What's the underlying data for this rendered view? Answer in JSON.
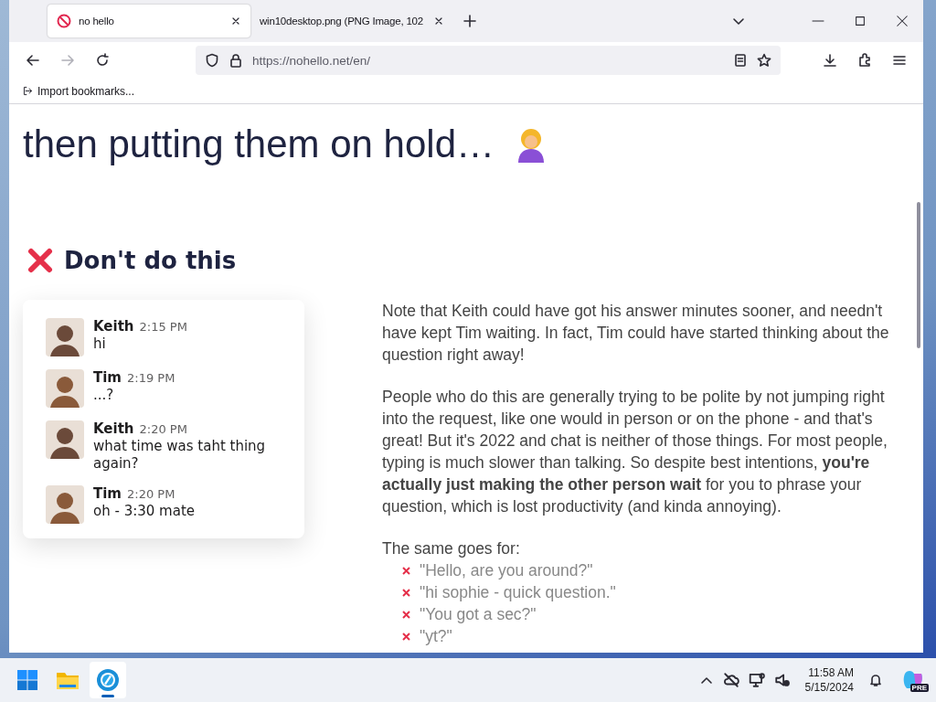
{
  "browser": {
    "tabs": [
      {
        "title": "no hello",
        "selected": true
      },
      {
        "title": "win10desktop.png (PNG Image, 102",
        "selected": false
      }
    ],
    "url": "https://nohello.net/en/",
    "bookmarks": [
      "Import bookmarks..."
    ]
  },
  "page": {
    "heading": "then putting them on hold…",
    "section_title": "Don't do this",
    "chat": [
      {
        "author": "Keith",
        "time": "2:15 PM",
        "text": "hi",
        "color": "#6b4a3a"
      },
      {
        "author": "Tim",
        "time": "2:19 PM",
        "text": "...?",
        "color": "#8a5a3a"
      },
      {
        "author": "Keith",
        "time": "2:20 PM",
        "text": "what time was taht thing again?",
        "color": "#6b4a3a"
      },
      {
        "author": "Tim",
        "time": "2:20 PM",
        "text": "oh - 3:30 mate",
        "color": "#8a5a3a"
      }
    ],
    "paragraphs": [
      "Note that Keith could have got his answer minutes sooner, and needn't have kept Tim waiting. In fact, Tim could have started thinking about the question right away!",
      "People who do this are generally trying to be polite by not jumping right into the request, like one would in person or on the phone - and that's great! But it's 2022 and chat is neither of those things. For most people, typing is much slower than talking. So despite best intentions, **you're actually just making the other person wait** for you to phrase your question, which is lost productivity (and kinda annoying)."
    ],
    "list_intro": "The same goes for:",
    "examples": [
      "\"Hello, are you around?\"",
      "\"hi sophie - quick question.\"",
      "\"You got a sec?\"",
      "\"yt?\""
    ]
  },
  "taskbar": {
    "apps": [
      {
        "kind": "start",
        "selected": false
      },
      {
        "kind": "files",
        "selected": false
      },
      {
        "kind": "browser",
        "selected": true
      }
    ],
    "time": "11:58 AM",
    "date": "5/15/2024",
    "copilot_badge": "PRE"
  }
}
